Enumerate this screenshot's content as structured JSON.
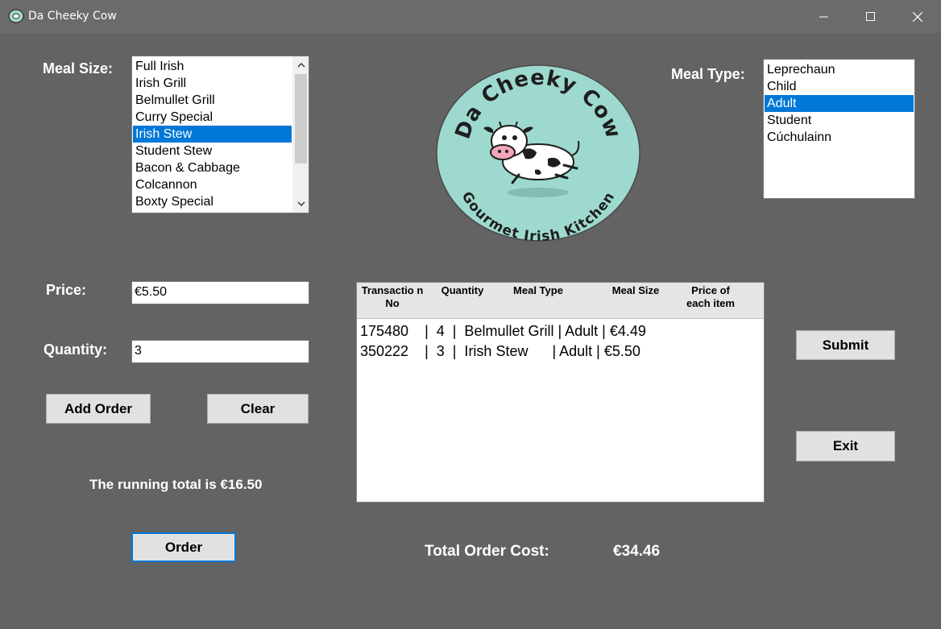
{
  "window": {
    "title": "Da Cheeky Cow",
    "controls": {
      "minimize": "—",
      "maximize": "☐",
      "close": "✕"
    }
  },
  "meal_size": {
    "label": "Meal Size:",
    "items": [
      "Full Irish",
      "Irish Grill",
      "Belmullet Grill",
      "Curry Special",
      "Irish Stew",
      "Student Stew",
      "Bacon & Cabbage",
      "Colcannon",
      "Boxty Special"
    ],
    "selected": "Irish Stew"
  },
  "meal_type": {
    "label": "Meal Type:",
    "items": [
      "Leprechaun",
      "Child",
      "Adult",
      "Student",
      "Cúchulainn"
    ],
    "selected": "Adult"
  },
  "logo": {
    "top_text": "Da Cheeky Cow",
    "bottom_text": "Gourmet Irish Kitchen",
    "badge_color": "#9dd9cf"
  },
  "price": {
    "label": "Price:",
    "value": "€5.50"
  },
  "quantity": {
    "label": "Quantity:",
    "value": "3"
  },
  "buttons": {
    "add_order": "Add Order",
    "clear": "Clear",
    "order": "Order",
    "submit": "Submit",
    "exit": "Exit"
  },
  "running_total": "The running total is €16.50",
  "orders": {
    "columns": [
      "Transactio n No",
      "Quantity",
      "Meal Type",
      "Meal Size",
      "Price of each item"
    ],
    "rows": [
      "175480    |  4  |  Belmullet Grill | Adult | €4.49",
      "350222    |  3  |  Irish Stew      | Adult | €5.50"
    ]
  },
  "total": {
    "label": "Total Order Cost:",
    "value": "€34.46"
  },
  "colors": {
    "background": "#636363",
    "titlebar": "#6b6b6b",
    "selection": "#0078d7",
    "button": "#e1e1e1",
    "focus_border": "#0078d7"
  }
}
